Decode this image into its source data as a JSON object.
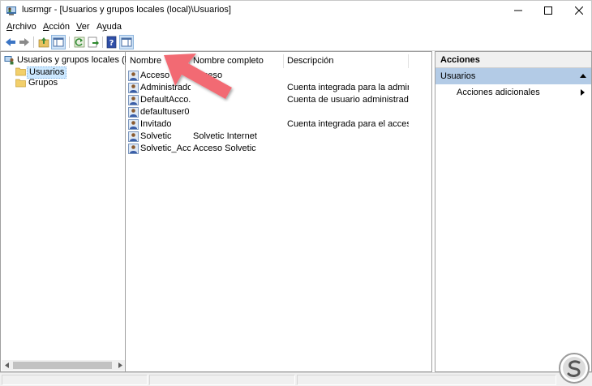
{
  "window": {
    "title": "lusrmgr - [Usuarios y grupos locales (local)\\Usuarios]"
  },
  "menu": {
    "items": [
      {
        "label": "Archivo",
        "accel": "A",
        "rest": "rchivo"
      },
      {
        "label": "Acción",
        "accel": "A",
        "rest": "cción"
      },
      {
        "label": "Ver",
        "accel": "V",
        "rest": "er"
      },
      {
        "label": "Ayuda",
        "accel": "y",
        "rest": "uda",
        "pre": "A"
      }
    ]
  },
  "tree": {
    "root": "Usuarios y grupos locales (local)",
    "children": [
      "Usuarios",
      "Grupos"
    ],
    "selected": "Usuarios"
  },
  "list": {
    "columns": [
      "Nombre",
      "Nombre completo",
      "Descripción"
    ],
    "rows": [
      {
        "name": "Acceso",
        "fullname": "Acceso",
        "description": ""
      },
      {
        "name": "Administrador",
        "fullname": "",
        "description": "Cuenta integrada para la administ..."
      },
      {
        "name": "DefaultAcco...",
        "fullname": "",
        "description": "Cuenta de usuario administrada p..."
      },
      {
        "name": "defaultuser0",
        "fullname": "",
        "description": ""
      },
      {
        "name": "Invitado",
        "fullname": "",
        "description": "Cuenta integrada para el acceso c..."
      },
      {
        "name": "Solvetic",
        "fullname": "Solvetic Internet",
        "description": ""
      },
      {
        "name": "Solvetic_Acc...",
        "fullname": "Acceso Solvetic",
        "description": ""
      }
    ]
  },
  "actions": {
    "header": "Acciones",
    "section": "Usuarios",
    "item": "Acciones adicionales"
  },
  "colors": {
    "selection": "#cce8ff",
    "actions_section": "#b3cbe6",
    "annotation_arrow": "#f26b73"
  }
}
